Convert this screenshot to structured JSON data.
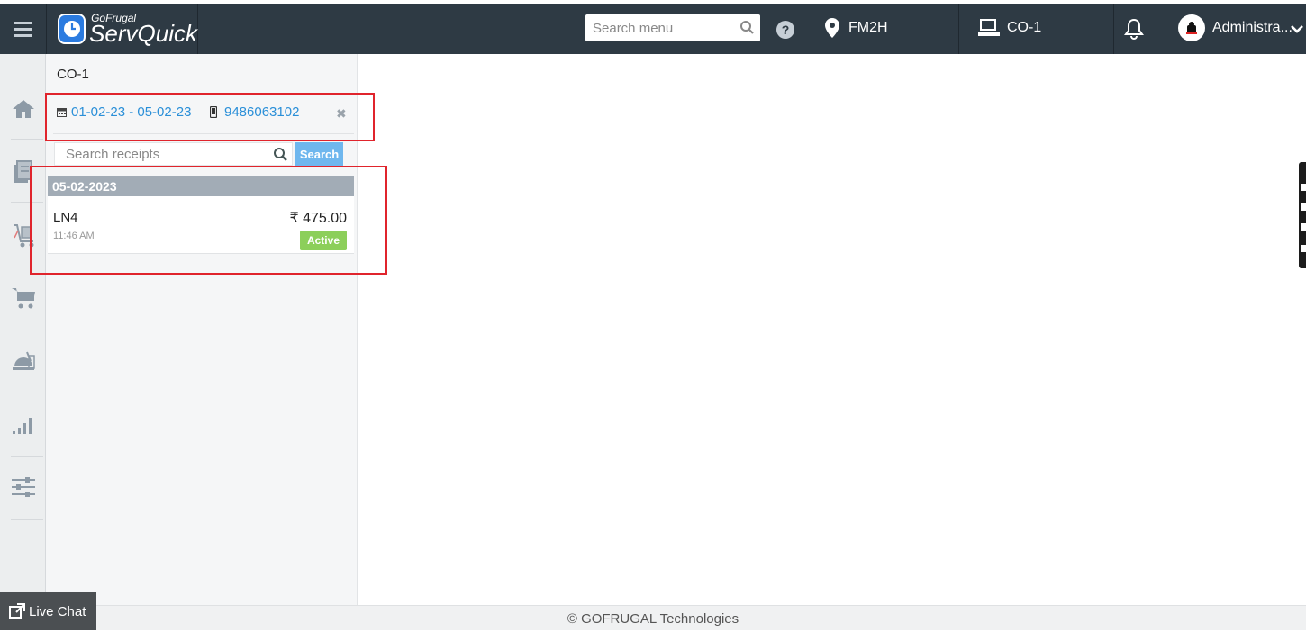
{
  "header": {
    "brand_small": "GoFrugal",
    "brand_big": "ServQuick",
    "search_placeholder": "Search menu",
    "location": "FM2H",
    "counter": "CO-1",
    "user": "Administra..."
  },
  "sidebar": {
    "items": [
      {
        "icon": "home-icon"
      },
      {
        "icon": "receipts-icon"
      },
      {
        "icon": "purchase-icon"
      },
      {
        "icon": "cart-icon"
      },
      {
        "icon": "kitchen-icon"
      },
      {
        "icon": "reports-icon"
      },
      {
        "icon": "settings-sliders-icon"
      }
    ]
  },
  "panel": {
    "title": "CO-1",
    "date_range": "01-02-23 - 05-02-23",
    "phone": "9486063102",
    "search_placeholder": "Search receipts",
    "search_button": "Search",
    "groups": [
      {
        "date": "05-02-2023",
        "receipts": [
          {
            "number": "LN4",
            "time": "11:46 AM",
            "amount": "₹ 475.00",
            "status": "Active"
          }
        ]
      }
    ]
  },
  "footer": {
    "copyright": "© GOFRUGAL Technologies",
    "live_chat": "Live Chat"
  },
  "colors": {
    "topbar": "#2e3a44",
    "link": "#2a8fd8",
    "active_badge": "#8ccf5a",
    "search_button": "#6fb7ee",
    "highlight": "#e0242c"
  }
}
